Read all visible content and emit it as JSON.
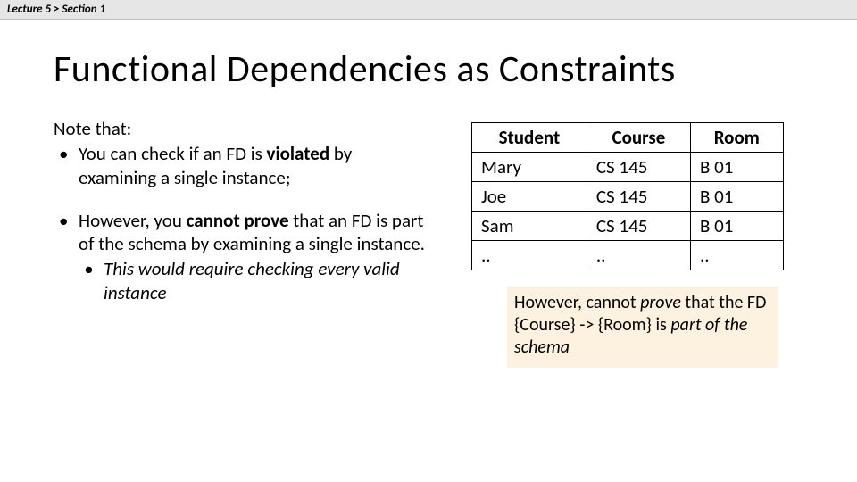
{
  "breadcrumb": "Lecture 5  >  Section 1",
  "title": "Functional Dependencies as Constraints",
  "note_intro": "Note that:",
  "bullet1_pre": "You can check if an FD is ",
  "bullet1_bold": "violated",
  "bullet1_post": " by examining a single instance;",
  "bullet2_pre": "However, you ",
  "bullet2_bold": "cannot prove",
  "bullet2_post": " that an FD is part of the schema by examining a single instance.",
  "bullet2_sub": "This would require checking every valid instance",
  "table": {
    "headers": [
      "Student",
      "Course",
      "Room"
    ],
    "rows": [
      [
        "Mary",
        "CS 145",
        "B 01"
      ],
      [
        "Joe",
        "CS 145",
        "B 01"
      ],
      [
        "Sam",
        "CS 145",
        "B 01"
      ],
      [
        "..",
        "..",
        ".."
      ]
    ]
  },
  "callout_pre": "However, cannot ",
  "callout_prove": "prove",
  "callout_mid": " that the FD {Course} -> {Room} is ",
  "callout_ital": "part of the schema"
}
